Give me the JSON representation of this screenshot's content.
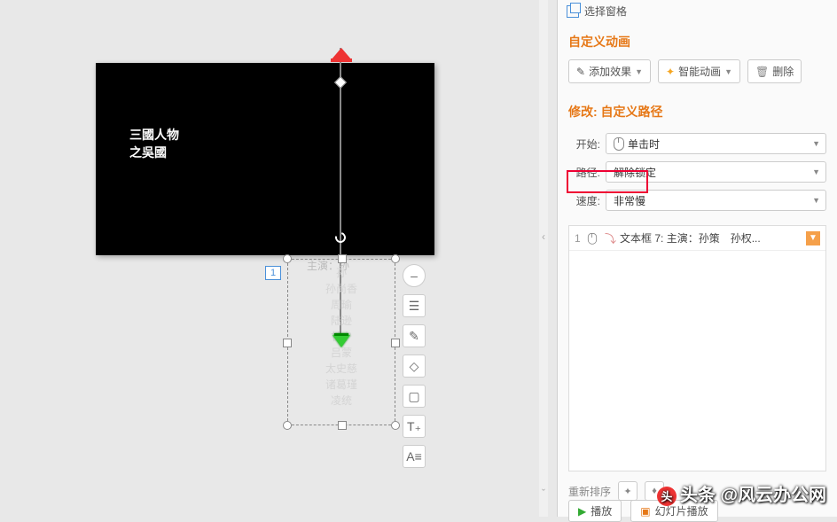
{
  "slide": {
    "title_l1": "三國人物",
    "title_l2": "之吳國"
  },
  "text_frame": {
    "heading": "主演：孙",
    "lines": [
      "孙",
      "孙尚香",
      "周瑜",
      "陆逊",
      "甘宁",
      "吕蒙",
      "太史慈",
      "诸葛瑾",
      "凌统"
    ],
    "seq": "1"
  },
  "float_icons": [
    "–",
    "☰",
    "✎",
    "◇",
    "▢",
    "T₊",
    "A≡"
  ],
  "top_link": "选择窗格",
  "sections": {
    "custom_anim": "自定义动画",
    "modify": "修改: 自定义路径"
  },
  "buttons": {
    "add": "添加效果",
    "smart": "智能动画",
    "delete": "删除"
  },
  "form": {
    "start_label": "开始:",
    "start_value": "单击时",
    "path_label": "路径:",
    "path_value": "解除锁定",
    "speed_label": "速度:",
    "speed_value": "非常慢"
  },
  "anim_item": {
    "num": "1",
    "text": "文本框 7: 主演：孙策　孙权..."
  },
  "bottom": {
    "reorder": "重新排序",
    "play": "播放",
    "slideshow": "幻灯片播放"
  },
  "watermark": "头条 @风云办公网"
}
